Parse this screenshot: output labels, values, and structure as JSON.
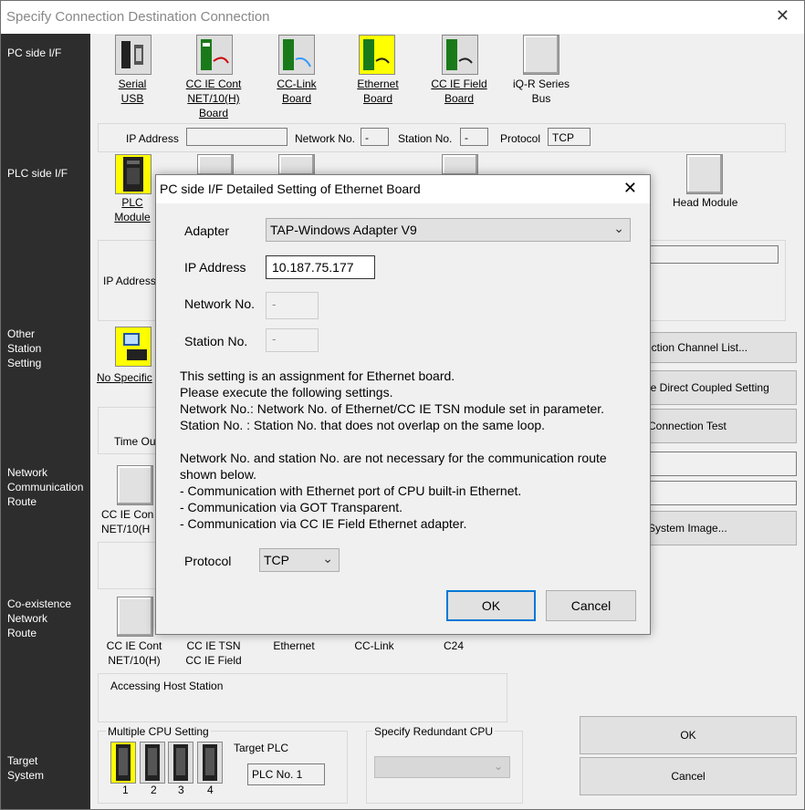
{
  "window": {
    "title": "Specify Connection Destination Connection",
    "close": "✕"
  },
  "left_labels": {
    "pc_side": "PC side I/F",
    "plc_side": "PLC side I/F",
    "other_station": [
      "Other",
      "Station",
      "Setting"
    ],
    "network_route": [
      "Network",
      "Communication",
      "Route"
    ],
    "coexistence": [
      "Co-existence",
      "Network",
      "Route"
    ],
    "target_system": [
      "Target",
      "System"
    ]
  },
  "pc_side_items": [
    {
      "l1": "Serial",
      "l2": "USB",
      "l3": ""
    },
    {
      "l1": "CC IE Cont",
      "l2": "NET/10(H)",
      "l3": "Board"
    },
    {
      "l1": "CC-Link",
      "l2": "Board",
      "l3": ""
    },
    {
      "l1": "Ethernet",
      "l2": "Board",
      "l3": ""
    },
    {
      "l1": "CC IE Field",
      "l2": "Board",
      "l3": ""
    },
    {
      "l1": "iQ-R Series",
      "l2": "Bus",
      "l3": ""
    }
  ],
  "pc_fields": {
    "ip_label": "IP Address",
    "ip_value": "",
    "network_label": "Network No.",
    "network_value": "-",
    "station_label": "Station No.",
    "station_value": "-",
    "protocol_label": "Protocol",
    "protocol_value": "TCP"
  },
  "plc_side": {
    "plc_module_l1": "PLC",
    "plc_module_l2": "Module",
    "head_module": "Head Module",
    "ip_label": "IP Address"
  },
  "other_station": {
    "no_spec": "No Specific",
    "time_out": "Time Ou"
  },
  "right_buttons": {
    "connection_channel": "ection Channel List...",
    "direct_coupled": "le Direct Coupled Setting",
    "connection_test": "Connection Test",
    "system_image": "System Image..."
  },
  "network_route": {
    "item1_l1": "CC IE Con",
    "item1_l2": "NET/10(H"
  },
  "coexistence": {
    "items": [
      {
        "l1": "CC IE Cont",
        "l2": "NET/10(H)"
      },
      {
        "l1": "CC IE TSN",
        "l2": "CC IE Field"
      },
      {
        "l1": "Ethernet",
        "l2": ""
      },
      {
        "l1": "CC-Link",
        "l2": ""
      },
      {
        "l1": "C24",
        "l2": ""
      }
    ]
  },
  "accessing": "Accessing Host Station",
  "multi_cpu": {
    "title": "Multiple CPU Setting",
    "target_plc_label": "Target PLC",
    "target_plc_value": "PLC No. 1",
    "numbers": [
      "1",
      "2",
      "3",
      "4"
    ]
  },
  "redundant": {
    "title": "Specify Redundant CPU",
    "value": ""
  },
  "main_buttons": {
    "ok": "OK",
    "cancel": "Cancel"
  },
  "dialog": {
    "title": "PC side I/F Detailed Setting of Ethernet Board",
    "close": "✕",
    "adapter_label": "Adapter",
    "adapter_value": "TAP-Windows Adapter V9",
    "ip_label": "IP Address",
    "ip_value": "10.187.75.177",
    "network_label": "Network No.",
    "network_value": "-",
    "station_label": "Station No.",
    "station_value": "-",
    "text_lines": [
      "This setting is an assignment for Ethernet board.",
      "Please execute the following settings.",
      "Network No.: Network No. of Ethernet/CC IE TSN module set in parameter.",
      "Station No.  : Station No. that does not overlap on the same loop.",
      "",
      "Network No. and station No. are not necessary for the communication route",
      "shown below.",
      "- Communication with Ethernet port of CPU built-in Ethernet.",
      "- Communication via GOT Transparent.",
      "- Communication via CC IE Field Ethernet adapter."
    ],
    "protocol_label": "Protocol",
    "protocol_value": "TCP",
    "ok": "OK",
    "cancel": "Cancel"
  },
  "colors": {
    "highlight": "#ffff00",
    "left_panel": "#2d2d2d",
    "ok_border": "#0078d7"
  }
}
